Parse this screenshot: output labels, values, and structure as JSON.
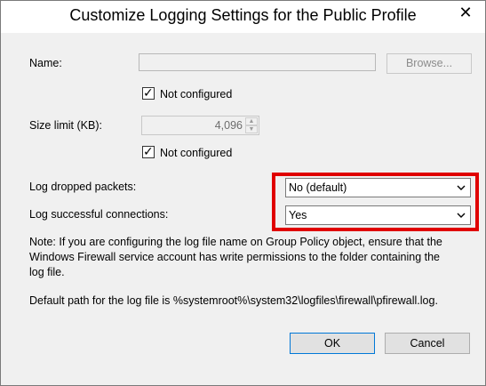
{
  "window": {
    "title": "Customize Logging Settings for the Public Profile",
    "close_glyph": "✕"
  },
  "name_field": {
    "label": "Name:",
    "value": "",
    "browse_label": "Browse...",
    "not_configured_label": "Not configured",
    "not_configured_checked": true
  },
  "size_limit": {
    "label": "Size limit (KB):",
    "value": "4,096",
    "not_configured_label": "Not configured",
    "not_configured_checked": true
  },
  "log_dropped": {
    "label": "Log dropped packets:",
    "selected": "No (default)"
  },
  "log_successful": {
    "label": "Log successful connections:",
    "selected": "Yes"
  },
  "note": {
    "line1": "Note: If you are configuring the log file name on Group Policy object, ensure that the",
    "line2": "Windows Firewall service account has write permissions to the folder containing the",
    "line3": "log file.",
    "default_path": "Default path for the log file is %systemroot%\\system32\\logfiles\\firewall\\pfirewall.log."
  },
  "buttons": {
    "ok": "OK",
    "cancel": "Cancel"
  },
  "colors": {
    "highlight": "#e00000",
    "face": "#f0f0f0"
  },
  "icons": {
    "close": "close-icon",
    "check": "checkmark-icon",
    "dropdown": "chevron-down-icon",
    "spin_up": "arrow-up-icon",
    "spin_down": "arrow-down-icon"
  }
}
